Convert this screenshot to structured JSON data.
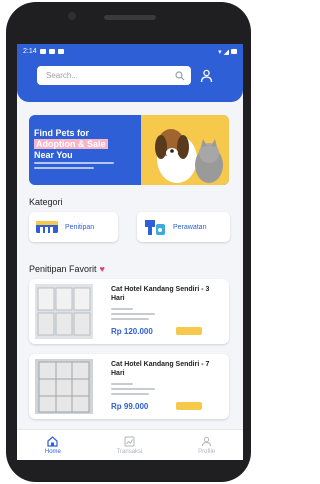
{
  "status": {
    "time": "2:14"
  },
  "search": {
    "placeholder": "Search..."
  },
  "banner": {
    "line1": "Find Pets for",
    "line2": "Adoption & Sale",
    "line3": "Near You"
  },
  "kategori": {
    "title": "Kategori",
    "items": [
      {
        "label": "Penitipan"
      },
      {
        "label": "Perawatan"
      }
    ]
  },
  "favorit": {
    "title": "Penitipan Favorit",
    "products": [
      {
        "title": "Cat Hotel Kandang Sendiri - 3 Hari",
        "price": "Rp 120.000"
      },
      {
        "title": "Cat Hotel Kandang Sendiri - 7 Hari",
        "price": "Rp 99.000"
      }
    ]
  },
  "nav": {
    "items": [
      {
        "label": "Home",
        "icon": "home-icon"
      },
      {
        "label": "Transaksi",
        "icon": "chart-icon"
      },
      {
        "label": "Profile",
        "icon": "user-icon"
      }
    ]
  },
  "colors": {
    "primary": "#2e5fd6",
    "accent": "#f6c94c",
    "heart": "#e63f6a"
  }
}
